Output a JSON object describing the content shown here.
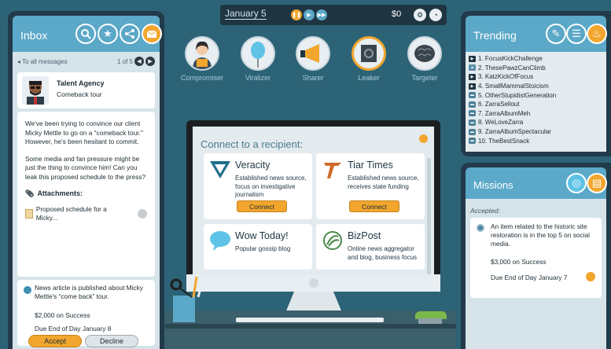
{
  "inbox": {
    "title": "Inbox",
    "back_link": "To all messages",
    "page_indicator": "1 of 5",
    "sender_name": "Talent Agency",
    "subject": "Comeback tour",
    "body_p1": "We've been trying to convince our client Micky Mettle to go on a \"comeback tour.\" However, he's been hesitant to commit.",
    "body_p2": "Some media and fan pressure might be just the thing to convince him! Can you leak this proposed schedule to the press?",
    "attachments_label": "Attachments:",
    "attachment_name": "Proposed schedule for a Micky...",
    "task_desc": "News article is published about Micky Mettle's “come back” tour.",
    "task_reward": "$2,000 on Success",
    "task_due": "Due End of Day January 8",
    "accept_label": "Accept",
    "decline_label": "Decline"
  },
  "topbar": {
    "date": "January 5",
    "money": "$0"
  },
  "roles": [
    {
      "label": "Compromiser",
      "icon": "person-icon"
    },
    {
      "label": "Viralizer",
      "icon": "balloon-icon"
    },
    {
      "label": "Sharer",
      "icon": "megaphone-icon"
    },
    {
      "label": "Leaker",
      "icon": "safe-icon"
    },
    {
      "label": "Targeter",
      "icon": "brain-icon"
    }
  ],
  "screen": {
    "title": "Connect to a recipient:",
    "recipients": [
      {
        "name": "Veracity",
        "desc": "Established news source, focus on investigative journalism",
        "button": "Connect"
      },
      {
        "name": "Tiar Times",
        "desc": "Established news source, receives state funding",
        "button": "Connect"
      },
      {
        "name": "Wow Today!",
        "desc": "Popular gossip blog"
      },
      {
        "name": "BizPost",
        "desc": "Online news aggregator and blog, business focus"
      }
    ]
  },
  "trending": {
    "title": "Trending",
    "items": [
      {
        "label": "1. FocusKickChallenge",
        "kind": "video"
      },
      {
        "label": "2. ThesePawzCanClimb",
        "kind": "image"
      },
      {
        "label": "3. KatzKickOfFocus",
        "kind": "video"
      },
      {
        "label": "4. SmallMammalStoicism",
        "kind": "video"
      },
      {
        "label": "5. OtherStupidistGeneration",
        "kind": "message"
      },
      {
        "label": "6. ZarraSellout",
        "kind": "message"
      },
      {
        "label": "7. ZarraAlbumMeh",
        "kind": "message"
      },
      {
        "label": "8. WeLoveZarra",
        "kind": "message"
      },
      {
        "label": "9. ZarraAlbumSpectacular",
        "kind": "message"
      },
      {
        "label": "10. TheBestSnack",
        "kind": "message"
      }
    ]
  },
  "missions": {
    "title": "Missions",
    "accepted_label": "Accepted:",
    "desc": "An item related to the historic site restoration is in the top 5 on social media.",
    "reward": "$3,000 on Success",
    "due": "Due End of Day January 7"
  },
  "colors": {
    "accent": "#f2a62e",
    "panel_blue": "#5ba8c8",
    "background": "#2c6377"
  }
}
